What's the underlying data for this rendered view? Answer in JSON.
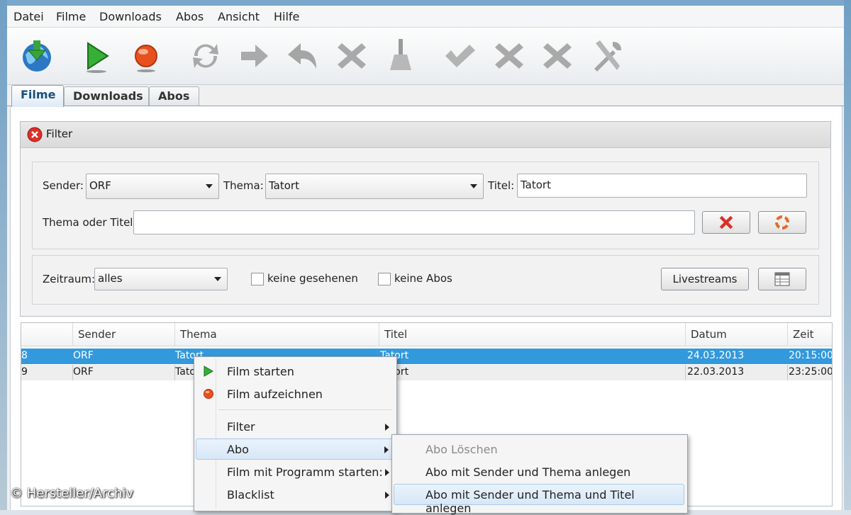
{
  "menubar": {
    "items": [
      "Datei",
      "Filme",
      "Downloads",
      "Abos",
      "Ansicht",
      "Hilfe"
    ]
  },
  "toolbar": {
    "icons": [
      "globe-download-icon",
      "play-icon",
      "record-icon",
      "refresh-icon",
      "forward-arrow-icon",
      "back-arrow-icon",
      "delete-icon",
      "broom-icon",
      "check-icon",
      "cross-icon",
      "cross-icon",
      "tools-icon"
    ]
  },
  "tabs": [
    {
      "label": "Filme",
      "active": true
    },
    {
      "label": "Downloads",
      "active": false
    },
    {
      "label": "Abos",
      "active": false
    }
  ],
  "filter": {
    "title": "Filter",
    "sender_label": "Sender:",
    "sender_value": "ORF",
    "thema_label": "Thema:",
    "thema_value": "Tatort",
    "titel_label": "Titel:",
    "titel_value": "Tatort",
    "thema_oder_titel_label": "Thema oder Titel:",
    "thema_oder_titel_value": "",
    "zeitraum_label": "Zeitraum:",
    "zeitraum_value": "alles",
    "keine_gesehenen_label": "keine gesehenen",
    "keine_abos_label": "keine Abos",
    "livestreams_label": "Livestreams"
  },
  "table": {
    "columns": [
      "",
      "Sender",
      "Thema",
      "Titel",
      "Datum",
      "Zeit"
    ],
    "rows": [
      {
        "nr": "8",
        "sender": "ORF",
        "thema": "Tatort",
        "titel": "Tatort",
        "datum": "24.03.2013",
        "zeit": "20:15:00",
        "selected": true
      },
      {
        "nr": "9",
        "sender": "ORF",
        "thema": "Tatort",
        "titel": "Tatort",
        "datum": "22.03.2013",
        "zeit": "23:25:00",
        "selected": false
      }
    ]
  },
  "context_menu": {
    "items": [
      {
        "label": "Film starten",
        "icon": "play-icon"
      },
      {
        "label": "Film aufzeichnen",
        "icon": "record-icon"
      },
      {
        "label": "Filter",
        "submenu": true
      },
      {
        "label": "Abo",
        "submenu": true,
        "highlighted": true
      },
      {
        "label": "Film mit Programm starten:",
        "submenu": true
      },
      {
        "label": "Blacklist",
        "submenu": true
      }
    ]
  },
  "abo_submenu": {
    "items": [
      {
        "label": "Abo Löschen",
        "disabled": true
      },
      {
        "label": "Abo mit Sender und Thema anlegen"
      },
      {
        "label": "Abo mit Sender und Thema und Titel anlegen",
        "highlighted": true
      }
    ]
  },
  "watermark": "© Hersteller/Archiv",
  "colors": {
    "selection": "#3399dd",
    "accent_red": "#d9302a",
    "accent_green": "#3aa43a"
  }
}
